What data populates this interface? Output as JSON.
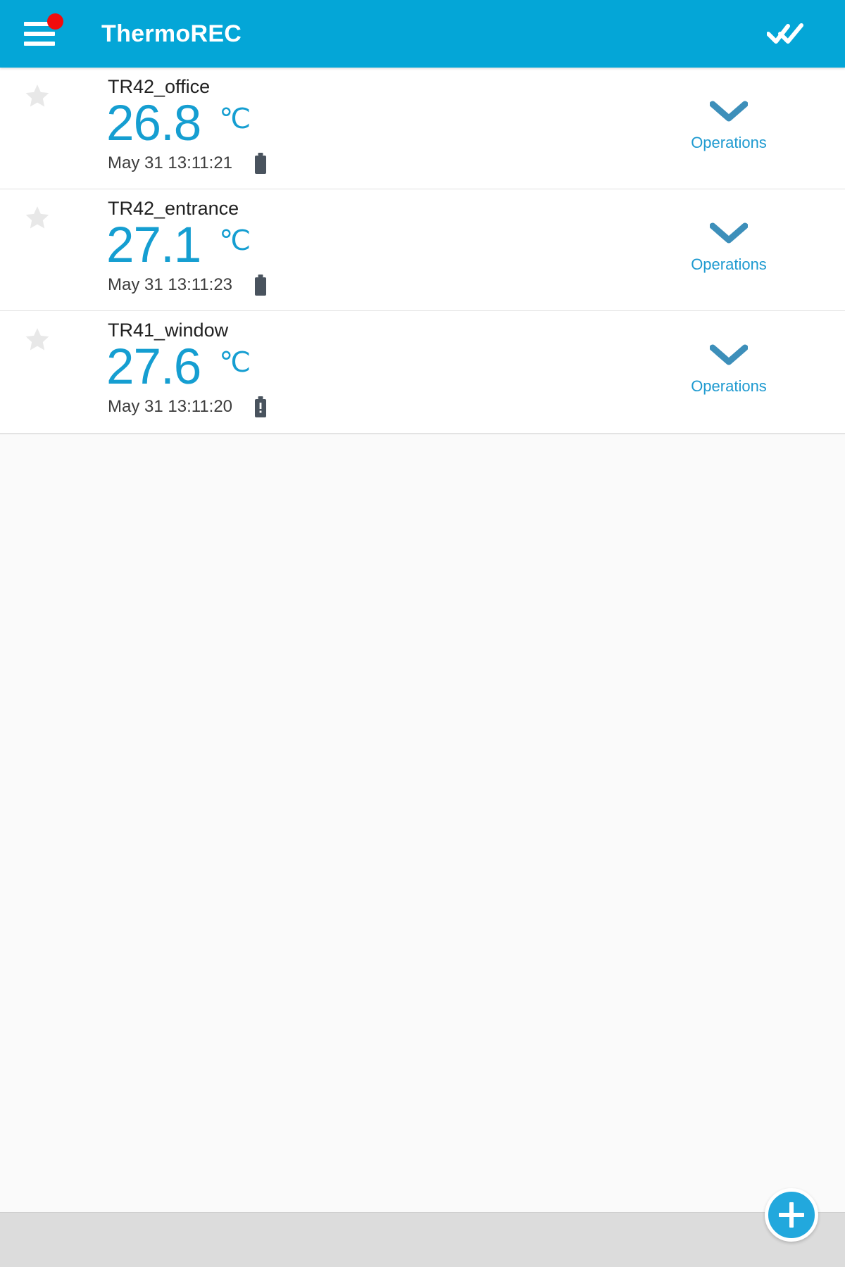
{
  "colors": {
    "appbar_bg": "#04a6d7",
    "badge_red": "#f10c0c",
    "temp_blue": "#159ed1",
    "ops_blue": "#1e9ad0",
    "chevron_blue": "#3d8fba",
    "star_gray": "#e8e8e8",
    "battery_gray": "#49535e",
    "fab_blue": "#22a8dd",
    "page_bg": "#fafafa",
    "bottombar_bg": "#dcdcdc"
  },
  "appbar": {
    "title": "ThermoREC",
    "menu_icon": "hamburger-menu-icon",
    "menu_badge_icon": "notification-dot-badge",
    "action_icon": "double-check-icon"
  },
  "list": {
    "rows": [
      {
        "name": "TR42_office",
        "temperature": "26.8",
        "unit": "℃",
        "timestamp": "May 31 13:11:21",
        "battery_icon": "battery-full-icon",
        "battery_alert": false,
        "star_icon": "star-outline-icon",
        "starred": false,
        "ops_label": "Operations",
        "ops_icon": "chevron-down-icon"
      },
      {
        "name": "TR42_entrance",
        "temperature": "27.1",
        "unit": "℃",
        "timestamp": "May 31 13:11:23",
        "battery_icon": "battery-full-icon",
        "battery_alert": false,
        "star_icon": "star-outline-icon",
        "starred": false,
        "ops_label": "Operations",
        "ops_icon": "chevron-down-icon"
      },
      {
        "name": "TR41_window",
        "temperature": "27.6",
        "unit": "℃",
        "timestamp": "May 31 13:11:20",
        "battery_icon": "battery-alert-icon",
        "battery_alert": true,
        "star_icon": "star-outline-icon",
        "starred": false,
        "ops_label": "Operations",
        "ops_icon": "chevron-down-icon"
      }
    ]
  },
  "bottombar": {
    "fab_icon": "plus-icon"
  }
}
